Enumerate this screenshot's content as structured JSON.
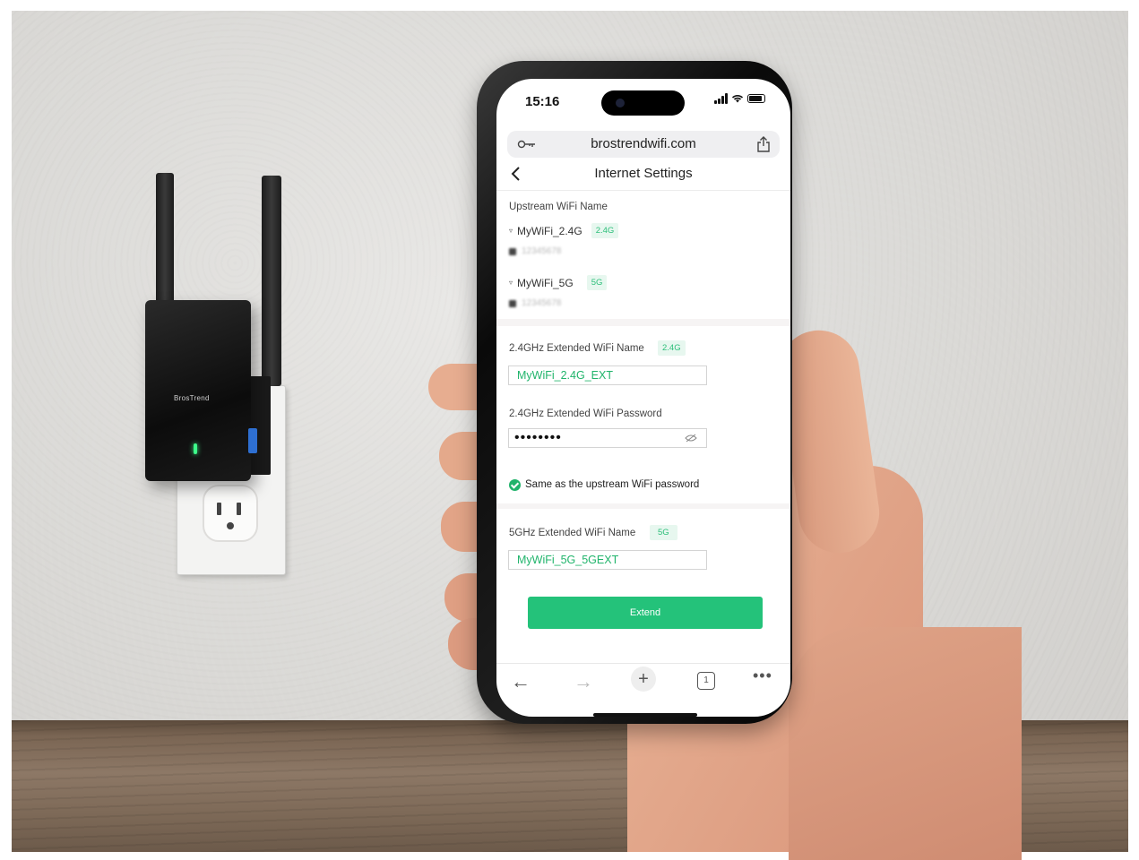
{
  "status_bar": {
    "time": "15:16"
  },
  "browser": {
    "url": "brostrendwifi.com",
    "tab_count": "1",
    "icons": [
      "key-icon",
      "share-icon",
      "back-arrow-icon",
      "forward-arrow-icon",
      "new-tab-plus-icon",
      "tab-count-icon",
      "more-icon"
    ]
  },
  "page": {
    "title": "Internet Settings",
    "upstream": {
      "label": "Upstream WiFi Name",
      "networks": [
        {
          "name": "MyWiFi_2.4G",
          "band": "2.4G",
          "password": "12345678"
        },
        {
          "name": "MyWiFi_5G",
          "band": "5G",
          "password": "12345678"
        }
      ]
    },
    "ext24": {
      "name_label": "2.4GHz Extended WiFi Name",
      "band": "2.4G",
      "name_value": "MyWiFi_2.4G_EXT",
      "password_label": "2.4GHz Extended WiFi Password",
      "password_value": "••••••••"
    },
    "same_password": {
      "label": "Same as the upstream WiFi password",
      "checked": true
    },
    "ext5": {
      "name_label": "5GHz Extended WiFi Name",
      "band": "5G",
      "name_value": "MyWiFi_5G_5GEXT"
    },
    "extend_button": "Extend"
  },
  "device": {
    "brand": "BrosTrend"
  },
  "colors": {
    "accent": "#24c27a",
    "tag_bg": "#e7f7ef",
    "tag_text": "#2dbf7a"
  }
}
